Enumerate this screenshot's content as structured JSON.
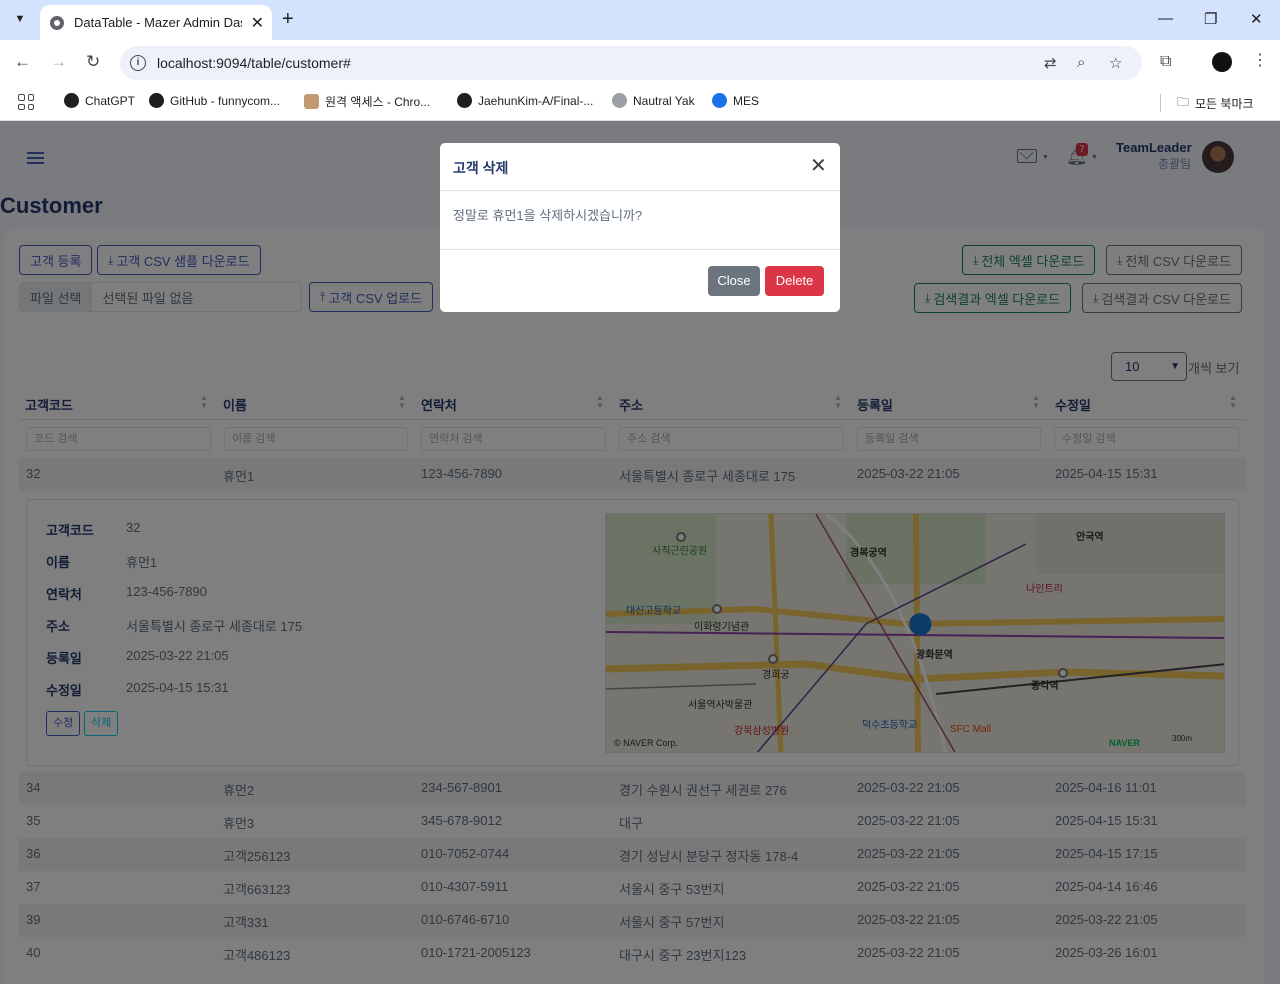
{
  "browser": {
    "tab_title": "DataTable - Mazer Admin Dashboard",
    "url": "localhost:9094/table/customer#",
    "bookmarks": [
      "ChatGPT",
      "GitHub - funnycom...",
      "원격 액세스 - Chro...",
      "JaehunKim-A/Final-...",
      "Nautral Yak",
      "MES"
    ],
    "all_bookmarks": "모든 북마크"
  },
  "header": {
    "notification_count": "7",
    "user_name": "TeamLeader",
    "user_role": "총괄팀"
  },
  "page_title": "Customer",
  "toolbar": {
    "register": "고객 등록",
    "csv_sample": "고객 CSV 샘플 다운로드",
    "file_select": "파일 선택",
    "no_file": "선택된 파일 없음",
    "csv_upload": "고객 CSV 업로드",
    "excel_all": "전체 엑셀 다운로드",
    "csv_all": "전체 CSV 다운로드",
    "excel_search": "검색결과 엑셀 다운로드",
    "csv_search": "검색결과 CSV 다운로드"
  },
  "per_page": {
    "value": "10",
    "label": "개씩 보기"
  },
  "table": {
    "columns": [
      "고객코드",
      "이름",
      "연락처",
      "주소",
      "등록일",
      "수정일"
    ],
    "filters": [
      "코드 검색",
      "이름 검색",
      "연락처 검색",
      "주소 검색",
      "등록일 검색",
      "수정일 검색"
    ],
    "first_row": [
      "32",
      "휴먼1",
      "123-456-7890",
      "서울특별시 종로구 세종대로 175",
      "2025-03-22 21:05",
      "2025-04-15 15:31"
    ],
    "rows": [
      [
        "34",
        "휴먼2",
        "234-567-8901",
        "경기 수원시 권선구 세권로 276",
        "2025-03-22 21:05",
        "2025-04-16 11:01"
      ],
      [
        "35",
        "휴먼3",
        "345-678-9012",
        "대구",
        "2025-03-22 21:05",
        "2025-04-15 15:31"
      ],
      [
        "36",
        "고객256123",
        "010-7052-0744",
        "경기 성남시 분당구 정자동 178-4",
        "2025-03-22 21:05",
        "2025-04-15 17:15"
      ],
      [
        "37",
        "고객663123",
        "010-4307-5911",
        "서울시 중구 53번지",
        "2025-03-22 21:05",
        "2025-04-14 16:46"
      ],
      [
        "39",
        "고객331",
        "010-6746-6710",
        "서울시 중구 57번지",
        "2025-03-22 21:05",
        "2025-03-22 21:05"
      ],
      [
        "40",
        "고객486123",
        "010-1721-2005123",
        "대구시 중구 23번지123",
        "2025-03-22 21:05",
        "2025-03-26 16:01"
      ]
    ]
  },
  "detail": {
    "labels": [
      "고객코드",
      "이름",
      "연락처",
      "주소",
      "등록일",
      "수정일"
    ],
    "values": [
      "32",
      "휴먼1",
      "123-456-7890",
      "서울특별시 종로구 세종대로 175",
      "2025-03-22 21:05",
      "2025-04-15 15:31"
    ],
    "edit": "수정",
    "delete": "삭제",
    "map_labels": [
      "사직근린공원",
      "경복궁역",
      "안국역",
      "광화문역",
      "종각역",
      "대신고등학교",
      "이화령기념관",
      "경희궁",
      "강북삼성병원",
      "서울역사박물관",
      "덕수초등학교",
      "SFC Mall",
      "나인트리",
      "300m"
    ],
    "map_copyright": "© NAVER Corp.",
    "map_brand": "NAVER"
  },
  "modal": {
    "title": "고객 삭제",
    "message": "정말로 휴먼1을 삭제하시겠습니까?",
    "close": "Close",
    "delete": "Delete"
  }
}
